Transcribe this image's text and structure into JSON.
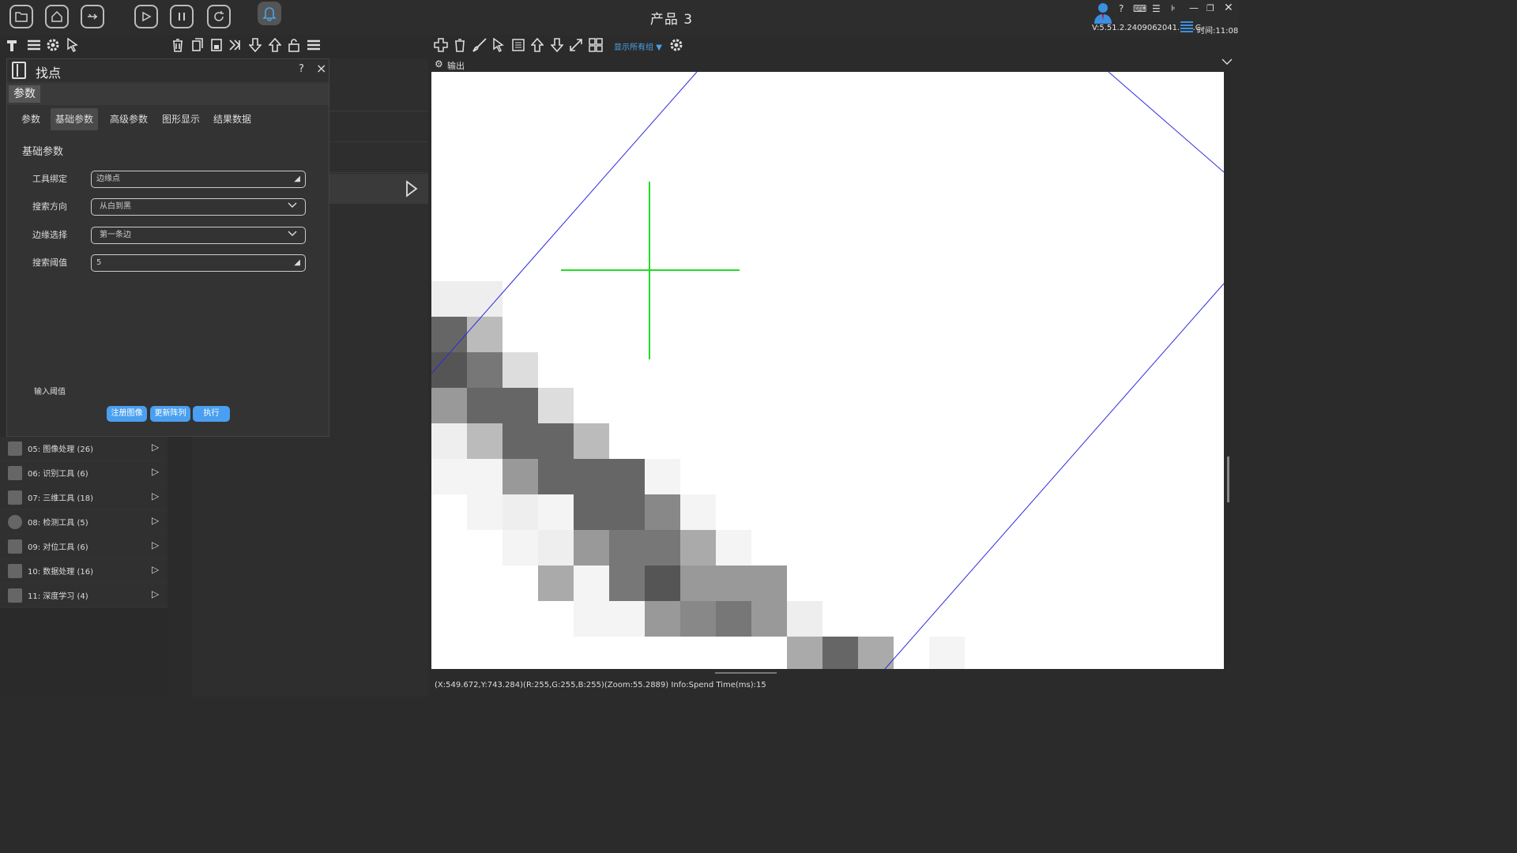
{
  "app": {
    "title": "产品 3",
    "version": "V:5.51.2.2409062041.B.S.C.",
    "time": "时间:11:08"
  },
  "panel": {
    "title": "找点",
    "section": "参数",
    "help": "?",
    "close": "×",
    "tabs": [
      "参数",
      "基础参数",
      "高级参数",
      "图形显示",
      "结果数据"
    ],
    "active_tab": "基础参数",
    "group_title": "基础参数",
    "fields": [
      {
        "label": "工具绑定",
        "value": "边缘点",
        "kind": "combo-edit"
      },
      {
        "label": "搜索方向",
        "value": "从白到黑",
        "kind": "select"
      },
      {
        "label": "边缘选择",
        "value": "第一条边",
        "kind": "select"
      },
      {
        "label": "搜索阈值",
        "value": "5",
        "kind": "combo-edit"
      }
    ],
    "input_hint": "输入阈值",
    "buttons": [
      "注册图像",
      "更新阵列",
      "执行"
    ]
  },
  "toolbox": [
    {
      "label": "05: 图像处理 (26)"
    },
    {
      "label": "06: 识别工具 (6)"
    },
    {
      "label": "07: 三维工具 (18)"
    },
    {
      "label": "08: 检测工具 (5)"
    },
    {
      "label": "09: 对位工具 (6)"
    },
    {
      "label": "10: 数据处理 (16)"
    },
    {
      "label": "11: 深度学习 (4)"
    }
  ],
  "view": {
    "group_select": "显示所有组",
    "output_label": "输出",
    "status": "(X:549.672,Y:743.284)(R:255,G:255,B:255)(Zoom:55.2889)  Info:Spend Time(ms):15"
  },
  "colors": {
    "accent": "#4a9ff0",
    "crosshair": "#22dd22",
    "edge_line": "#2b2bdd"
  },
  "icons": {
    "top": [
      "folder-icon",
      "home-icon",
      "usb-icon",
      "play-icon",
      "pause-icon",
      "refresh-icon",
      "bell-icon"
    ],
    "tools_left": [
      "hammer-icon",
      "menu-icon",
      "gear-icon",
      "cursor-icon"
    ],
    "tools_mid": [
      "delete-icon",
      "copy-icon",
      "save-icon",
      "forward-icon",
      "arrow-down-icon",
      "arrow-up-icon",
      "unlock-icon",
      "menu-icon"
    ],
    "view_tools": [
      "plus-icon",
      "delete-icon",
      "brush-icon",
      "cursor-icon",
      "window-icon",
      "arrow-up-icon",
      "arrow-down-icon",
      "expand-icon",
      "grid-icon",
      "gear-icon"
    ]
  }
}
